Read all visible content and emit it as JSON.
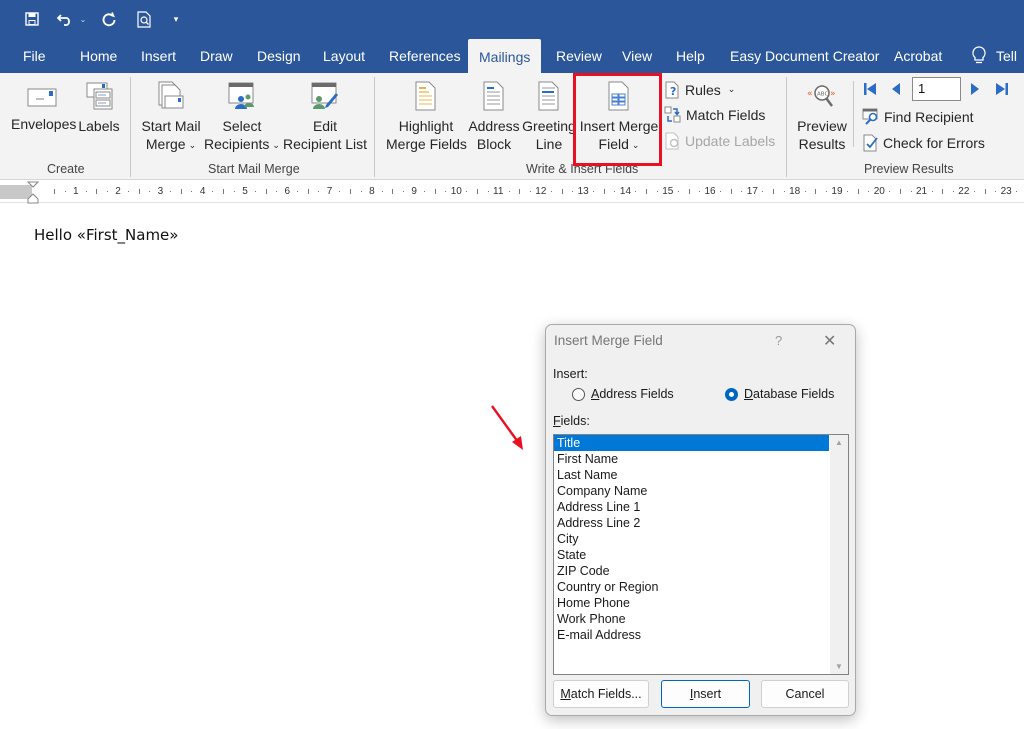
{
  "quick_access": {
    "save_icon": "save-icon",
    "undo_icon": "undo-icon",
    "redo_icon": "redo-icon",
    "print_preview_icon": "print-preview-icon",
    "customize_icon": "customize-qat-icon"
  },
  "tabs": [
    {
      "label": "File"
    },
    {
      "label": "Home"
    },
    {
      "label": "Insert"
    },
    {
      "label": "Draw"
    },
    {
      "label": "Design"
    },
    {
      "label": "Layout"
    },
    {
      "label": "References"
    },
    {
      "label": "Mailings",
      "active": true
    },
    {
      "label": "Review"
    },
    {
      "label": "View"
    },
    {
      "label": "Help"
    },
    {
      "label": "Easy Document Creator"
    },
    {
      "label": "Acrobat"
    },
    {
      "label": "Tell"
    }
  ],
  "ribbon": {
    "groups": {
      "create": "Create",
      "start_mail_merge": "Start Mail Merge",
      "write_insert": "Write & Insert Fields",
      "preview_results": "Preview Results"
    },
    "envelopes": "Envelopes",
    "labels": "Labels",
    "start_mail_merge_l1": "Start Mail",
    "start_mail_merge_l2": "Merge",
    "select_recipients_l1": "Select",
    "select_recipients_l2": "Recipients",
    "edit_recipient_l1": "Edit",
    "edit_recipient_l2": "Recipient List",
    "highlight_l1": "Highlight",
    "highlight_l2": "Merge Fields",
    "address_block_l1": "Address",
    "address_block_l2": "Block",
    "greeting_l1": "Greeting",
    "greeting_l2": "Line",
    "insert_merge_l1": "Insert Merge",
    "insert_merge_l2": "Field",
    "rules": "Rules",
    "match_fields": "Match Fields",
    "update_labels": "Update Labels",
    "preview_l1": "Preview",
    "preview_l2": "Results",
    "record_number": "1",
    "find_recipient": "Find Recipient",
    "check_errors": "Check for Errors"
  },
  "ruler": {
    "numbers": [
      "1",
      "2",
      "3",
      "4",
      "5",
      "6",
      "7",
      "8",
      "9",
      "10",
      "11",
      "12",
      "13",
      "14",
      "15",
      "16",
      "17",
      "18",
      "19",
      "20",
      "21",
      "22",
      "23"
    ]
  },
  "document": {
    "text": "Hello «First_Name»"
  },
  "dialog": {
    "title": "Insert Merge Field",
    "help": "?",
    "close": "✕",
    "insert_label": "Insert:",
    "radio_address": {
      "accel": "A",
      "rest": "ddress Fields",
      "checked": false
    },
    "radio_database": {
      "accel": "D",
      "rest": "atabase Fields",
      "checked": true
    },
    "fields_label": {
      "accel": "F",
      "rest": "ields:"
    },
    "fields": [
      "Title",
      "First Name",
      "Last Name",
      "Company Name",
      "Address Line 1",
      "Address Line 2",
      "City",
      "State",
      "ZIP Code",
      "Country or Region",
      "Home Phone",
      "Work Phone",
      "E-mail Address"
    ],
    "selected_field": "Title",
    "buttons": {
      "match_fields": {
        "accel": "M",
        "rest": "atch Fields..."
      },
      "insert": {
        "accel": "I",
        "rest": "nsert"
      },
      "cancel": "Cancel"
    }
  },
  "annotations": {
    "highlight_color": "#e81123",
    "arrow_color": "#e81123"
  }
}
